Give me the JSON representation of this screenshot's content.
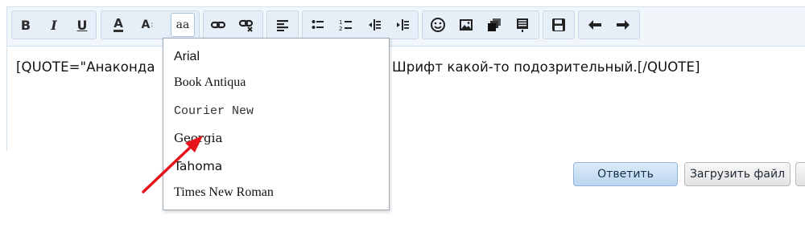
{
  "toolbar": {
    "buttons": [
      {
        "name": "bold",
        "glyph": "B"
      },
      {
        "name": "italic",
        "glyph": "I"
      },
      {
        "name": "underline",
        "glyph": "U"
      },
      {
        "name": "font-color",
        "glyph": "A"
      },
      {
        "name": "font-size",
        "glyph": "A"
      },
      {
        "name": "font-family",
        "glyph": "aa"
      }
    ],
    "icons": [
      "link-icon",
      "unlink-icon",
      "align-left-icon",
      "bullet-list-icon",
      "numbered-list-icon",
      "outdent-icon",
      "indent-icon",
      "smiley-icon",
      "image-icon",
      "media-icon",
      "quote-icon",
      "save-draft-icon",
      "undo-icon",
      "redo-icon"
    ],
    "active_color": "#ffffff"
  },
  "editor": {
    "text_before": "[QUOTE=\"Анаконда",
    "text_after": "Шрифт какой-то подозрительный.[/QUOTE]"
  },
  "font_menu": {
    "items": [
      "Arial",
      "Book Antiqua",
      "Courier New",
      "Georgia",
      "Tahoma",
      "Times New Roman"
    ]
  },
  "actions": {
    "reply_label": "Ответить",
    "upload_label": "Загрузить файл"
  },
  "annotation": {
    "arrow_color": "#e8141b"
  }
}
